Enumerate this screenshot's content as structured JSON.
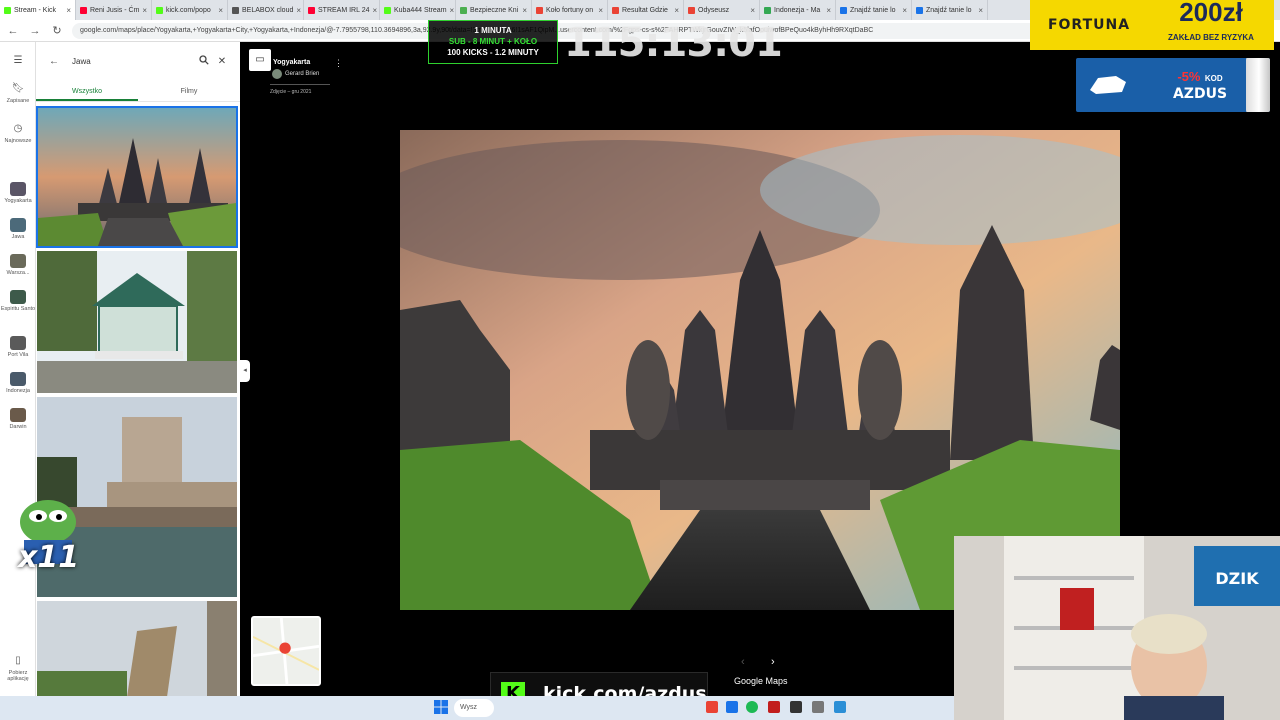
{
  "browser": {
    "tabs": [
      {
        "title": "Stream - Kick",
        "color": "#53fc18"
      },
      {
        "title": "Reni Jusis - Ćm",
        "color": "#ff0033"
      },
      {
        "title": "kick.com/popo",
        "color": "#53fc18"
      },
      {
        "title": "BELABOX cloud",
        "color": "#555555"
      },
      {
        "title": "STREAM IRL 24",
        "color": "#ff0033"
      },
      {
        "title": "Kuba444 Stream",
        "color": "#53fc18"
      },
      {
        "title": "Bezpieczne Kni",
        "color": "#4caf50"
      },
      {
        "title": "Koło fortuny on",
        "color": "#ea4335"
      },
      {
        "title": "Resultat Gdzie",
        "color": "#ea4335"
      },
      {
        "title": "Odyseusz",
        "color": "#ea4335"
      },
      {
        "title": "Indonezja - Ma",
        "color": "#34a853"
      },
      {
        "title": "Znajdź tanie lo",
        "color": "#1a73e8"
      },
      {
        "title": "Znajdź tanie lo",
        "color": "#1a73e8"
      }
    ],
    "url": "google.com/maps/place/Yogyakarta,+Yogyakarta+City,+Yogyakarta,+Indonezja/@-7.7955798,110.3694896,3a,92.9y,90t/data=!3m8!1e2!3m6!1sAF1QipM...usercontent.com/%2Fgps-cs-s%2FAHRPTWkjrGouvZIW_k5lafOouiwofBPeQuo4kByhHh9RXqtDaBC"
  },
  "rail": {
    "items": [
      {
        "label": "Zapisane",
        "icon": "bookmark-icon"
      },
      {
        "label": "Najnowsze",
        "icon": "history-icon"
      },
      {
        "label": "Yogyakarta",
        "icon": "place-thumb"
      },
      {
        "label": "Jawa",
        "icon": "place-thumb"
      },
      {
        "label": "Warsza...",
        "icon": "place-thumb"
      },
      {
        "label": "Espiritu Santo",
        "icon": "place-thumb"
      },
      {
        "label": "Port Vila",
        "icon": "place-thumb"
      },
      {
        "label": "Indonezja",
        "icon": "place-thumb"
      },
      {
        "label": "Darwin",
        "icon": "place-thumb"
      }
    ],
    "download_label": "Pobierz aplikację"
  },
  "panel": {
    "search_value": "Jawa",
    "tabs": [
      {
        "label": "Wszystko",
        "active": true
      },
      {
        "label": "Filmy",
        "active": false
      }
    ]
  },
  "viewer": {
    "place": "Yogyakarta",
    "author": "Gerard Brien",
    "date": "Zdjęcie – gru 2021",
    "brand": "Google Maps"
  },
  "overlays": {
    "sub_line1": "1 MINUTA",
    "sub_line2": "SUB - 8 MINUT + KOŁO",
    "sub_line3": "100 KICKS - 1.2 MINUTY",
    "timer": "115:13:01",
    "fortuna_logo": "FORTUNA",
    "fortuna_amount": "200zł",
    "fortuna_sub": "ZAKŁAD BEZ RYZYKA",
    "promo_pct": "-5%",
    "promo_kod": "KOD",
    "promo_code": "AZDUS",
    "dzik_logo": "DZIK",
    "pepe_mult": "x11",
    "kick_url": "kick.com/azdus"
  },
  "taskbar": {
    "search_label": "Wysz"
  }
}
